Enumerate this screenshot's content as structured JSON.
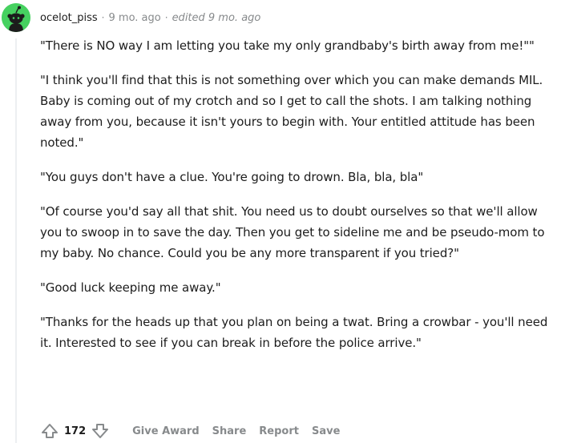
{
  "comment": {
    "author": "ocelot_piss",
    "separator": "·",
    "time_ago": "9 mo. ago",
    "edited": "edited 9 mo. ago",
    "avatar_icon": "snoo-avatar-icon",
    "accent_color": "#46d160",
    "paragraphs": [
      "\"There is NO way I am letting you take my only grandbaby's birth away from me!\"\"",
      "\"I think you'll find that this is not something over which you can make demands MIL. Baby is coming out of my crotch and so I get to call the shots. I am talking nothing away from you, because it isn't yours to begin with. Your entitled attitude has been noted.\"",
      "\"You guys don't have a clue. You're going to drown. Bla, bla, bla\"",
      "\"Of course you'd say all that shit. You need us to doubt ourselves so that we'll allow you to swoop in to save the day. Then you get to sideline me and be pseudo-mom to my baby. No chance. Could you be any more transparent if you tried?\"",
      "\"Good luck keeping me away.\"",
      "\"Thanks for the heads up that you plan on being a twat. Bring a crowbar - you'll need it. Interested to see if you can break in before the police arrive.\""
    ]
  },
  "actions": {
    "upvote_icon": "upvote-arrow-icon",
    "score": "172",
    "downvote_icon": "downvote-arrow-icon",
    "give_award": "Give Award",
    "share": "Share",
    "report": "Report",
    "save": "Save"
  }
}
